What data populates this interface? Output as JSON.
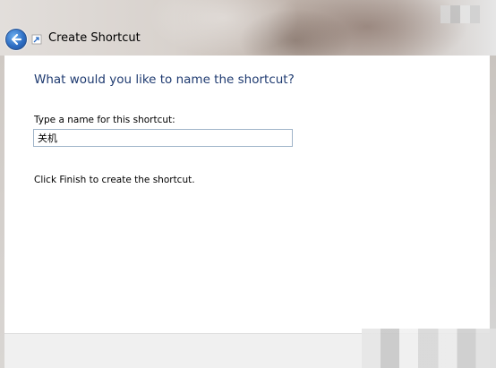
{
  "window": {
    "title": "Create Shortcut",
    "back_icon": "back-arrow-icon",
    "wizard_icon": "shortcut-wizard-icon"
  },
  "page": {
    "heading": "What would you like to name the shortcut?",
    "name_label": "Type a name for this shortcut:",
    "name_value": "关机",
    "instruction": "Click Finish to create the shortcut."
  },
  "colors": {
    "heading": "#1e3a70",
    "back_button": "#2f6fc4"
  }
}
